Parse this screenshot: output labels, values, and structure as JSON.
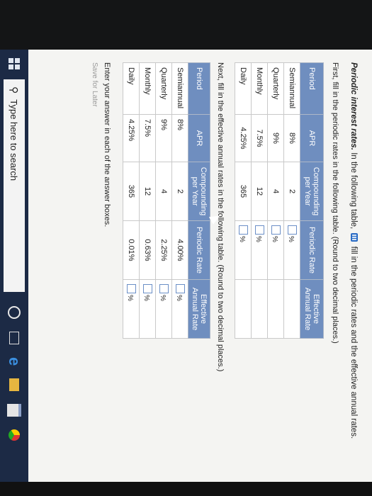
{
  "question": {
    "title": "Periodic interest rates.",
    "intro_a": "In the following table,",
    "intro_b": "fill in the periodic rates and the effective annual rates."
  },
  "part1": {
    "instruction": "First, fill in the periodic rates in the following table.  (Round to two decimal places.)",
    "headers": [
      "Period",
      "APR",
      "Compounding per Year",
      "Periodic Rate",
      "Effective Annual Rate"
    ],
    "rows": [
      {
        "period": "Semiannual",
        "apr": "8%",
        "comp": "2",
        "pct": "%"
      },
      {
        "period": "Quarterly",
        "apr": "9%",
        "comp": "4",
        "pct": "%"
      },
      {
        "period": "Monthly",
        "apr": "7.5%",
        "comp": "12",
        "pct": "%"
      },
      {
        "period": "Daily",
        "apr": "4.25%",
        "comp": "365",
        "pct": "%"
      }
    ]
  },
  "part2": {
    "instruction": "Next, fill in the effective annual rates in the following table.  (Round to two decimal places.)",
    "headers": [
      "Period",
      "APR",
      "Compounding per Year",
      "Periodic Rate",
      "Effective Annual Rate"
    ],
    "rows": [
      {
        "period": "Semiannual",
        "apr": "8%",
        "comp": "2",
        "rate": "4.00%",
        "pct": "%"
      },
      {
        "period": "Quarterly",
        "apr": "9%",
        "comp": "4",
        "rate": "2.25%",
        "pct": "%"
      },
      {
        "period": "Monthly",
        "apr": "7.5%",
        "comp": "12",
        "rate": "0.63%",
        "pct": "%"
      },
      {
        "period": "Daily",
        "apr": "4.25%",
        "comp": "365",
        "rate": "0.01%",
        "pct": "%"
      }
    ]
  },
  "footer": {
    "enter_text": "Enter your answer in each of the answer boxes.",
    "save_later": "Save for Later"
  },
  "taskbar": {
    "search_text": "Type here to search"
  },
  "colors": {
    "header_bg": "#6f8ebf",
    "taskbar_bg": "#1c2a45"
  }
}
